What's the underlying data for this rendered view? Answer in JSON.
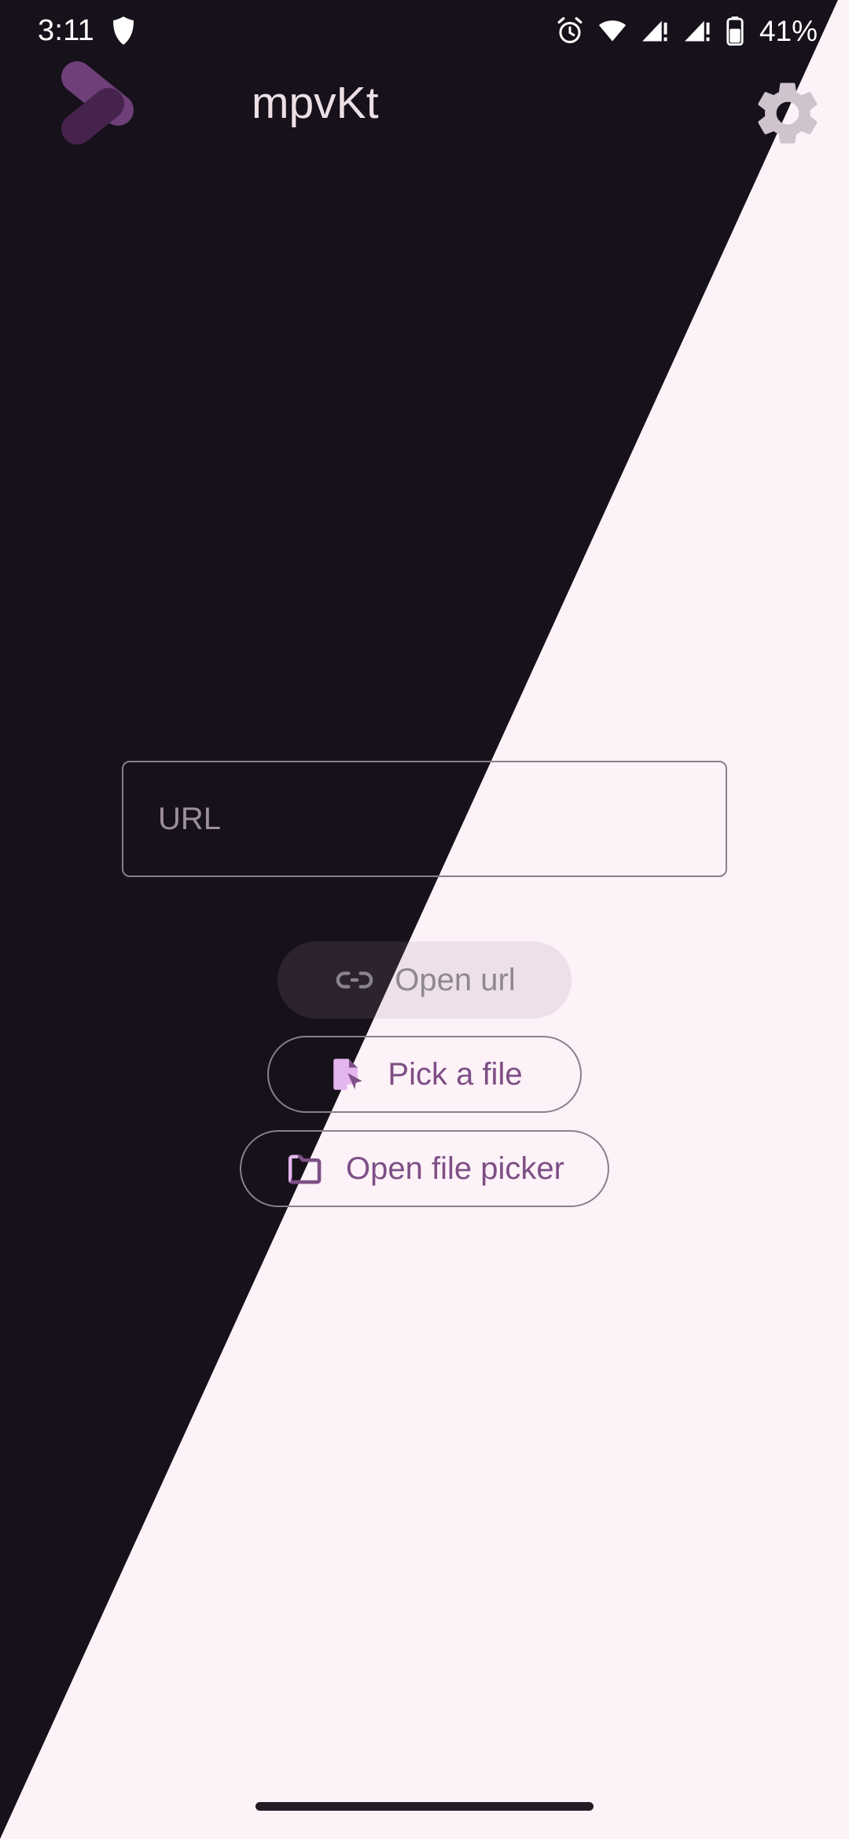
{
  "status_bar": {
    "time": "3:11",
    "battery_percent": "41%",
    "icons": [
      "shield-icon",
      "alarm-icon",
      "wifi-icon",
      "signal-sim1-icon",
      "signal-sim2-icon",
      "battery-icon"
    ]
  },
  "app_bar": {
    "title": "mpvKt",
    "logo_name": "mpvkt-chevron-logo",
    "settings_label": "Settings",
    "settings_icon": "gear-icon"
  },
  "main": {
    "url_input": {
      "value": "",
      "placeholder": "URL"
    },
    "buttons": [
      {
        "id": "open-url",
        "label": "Open url",
        "icon": "link-icon",
        "enabled": false,
        "style": "filled"
      },
      {
        "id": "pick-file",
        "label": "Pick a file",
        "icon": "file-cursor-icon",
        "enabled": true,
        "style": "outlined"
      },
      {
        "id": "open-picker",
        "label": "Open file picker",
        "icon": "folder-icon",
        "enabled": true,
        "style": "outlined"
      }
    ]
  },
  "nav": {
    "gesture_bar": "home-gesture-bar"
  },
  "colors": {
    "dark_background": "#16111a",
    "light_background": "#fdf2f7",
    "accent_purple": "#7d4f86",
    "accent_purple_light": "#e3b6ef",
    "logo_purple": "#6e3f78",
    "outline": "#8a7f8a",
    "disabled_text": "#8f8890",
    "title_text": "#ece0e6"
  }
}
